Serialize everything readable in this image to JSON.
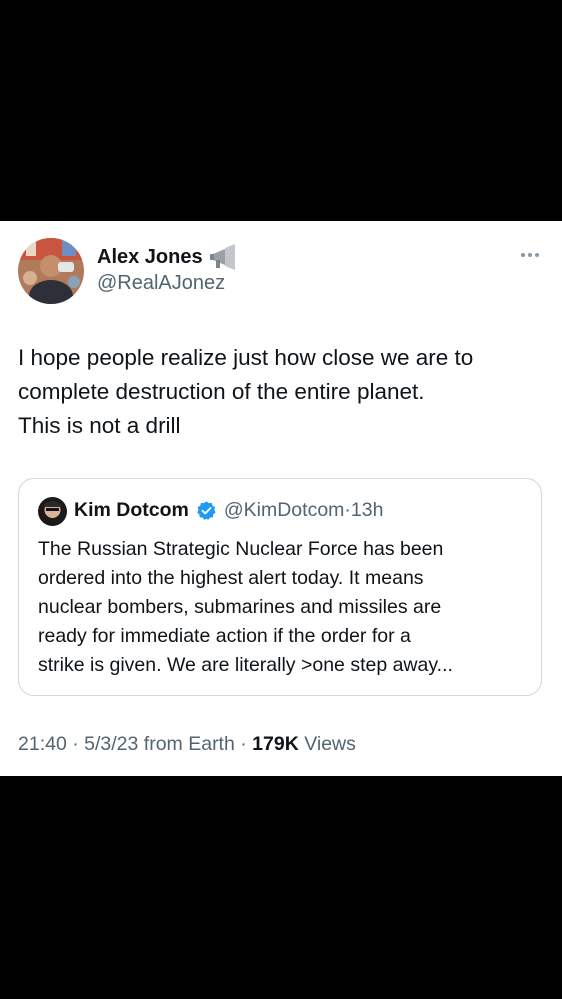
{
  "tweet": {
    "author": {
      "name": "Alex Jones",
      "handle": "@RealAJonez",
      "name_emoji_icon": "megaphone-icon"
    },
    "menu_icon": "more-icon",
    "text_lines": [
      "I hope people realize just how close we are to",
      "complete destruction of the entire planet.",
      "This is not a drill"
    ],
    "quoted": {
      "name": "Kim Dotcom",
      "verified_icon": "verified-badge-icon",
      "handle": "@KimDotcom",
      "separator": "·",
      "time": "13h",
      "text_lines": [
        "The Russian Strategic Nuclear Force has been",
        "ordered into the highest alert today. It means",
        "nuclear bombers, submarines and missiles are",
        "ready for immediate action if the order for a",
        "strike is given. We are literally >one step away..."
      ]
    },
    "footer": {
      "time": "21:40",
      "sep1": "·",
      "date": "5/3/23",
      "source": "from Earth",
      "sep2": "·",
      "views_count": "179K",
      "views_label": "Views"
    }
  },
  "colors": {
    "background": "#000000",
    "card": "#ffffff",
    "text_primary": "#0f1419",
    "text_secondary": "#536471",
    "verified_blue": "#1d9bf0",
    "border": "#cfd9de"
  }
}
